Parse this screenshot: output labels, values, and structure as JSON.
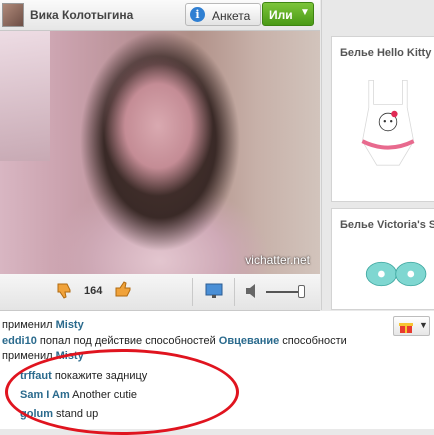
{
  "header": {
    "username": "Вика Колотыгина",
    "profile_label": "Анкета",
    "or_label": "Или",
    "or_chevron": "▼",
    "info_icon_glyph": "i"
  },
  "video": {
    "watermark": "vichatter.net"
  },
  "controls": {
    "rating": "164"
  },
  "ads": [
    {
      "title": "Белье Hello Kitty"
    },
    {
      "title": "Белье Victoria's Secret"
    }
  ],
  "chat": {
    "lines": [
      {
        "pre": "применил ",
        "nick": "Misty",
        "post": "",
        "nick2": "",
        "post2": ""
      },
      {
        "pre": "",
        "nick": "eddi10",
        "post": " попал под действие способностей ",
        "nick2": "Овцевание",
        "post2": " способности"
      },
      {
        "pre": "применил ",
        "nick": "Misty",
        "post": "",
        "nick2": "",
        "post2": ""
      },
      {
        "pre": "",
        "nick": "trffaut",
        "post": " покажите задницу",
        "nick2": "",
        "post2": ""
      },
      {
        "pre": "",
        "nick": "Sam I Am",
        "post": " Another cutie",
        "nick2": "",
        "post2": ""
      },
      {
        "pre": "",
        "nick": "golum",
        "post": " stand up",
        "nick2": "",
        "post2": ""
      }
    ],
    "gift_chevron": "▼"
  },
  "colors": {
    "accent_green": "#5aad24",
    "nick_blue": "#2a6a8d",
    "annotation_red": "#e0141f"
  }
}
